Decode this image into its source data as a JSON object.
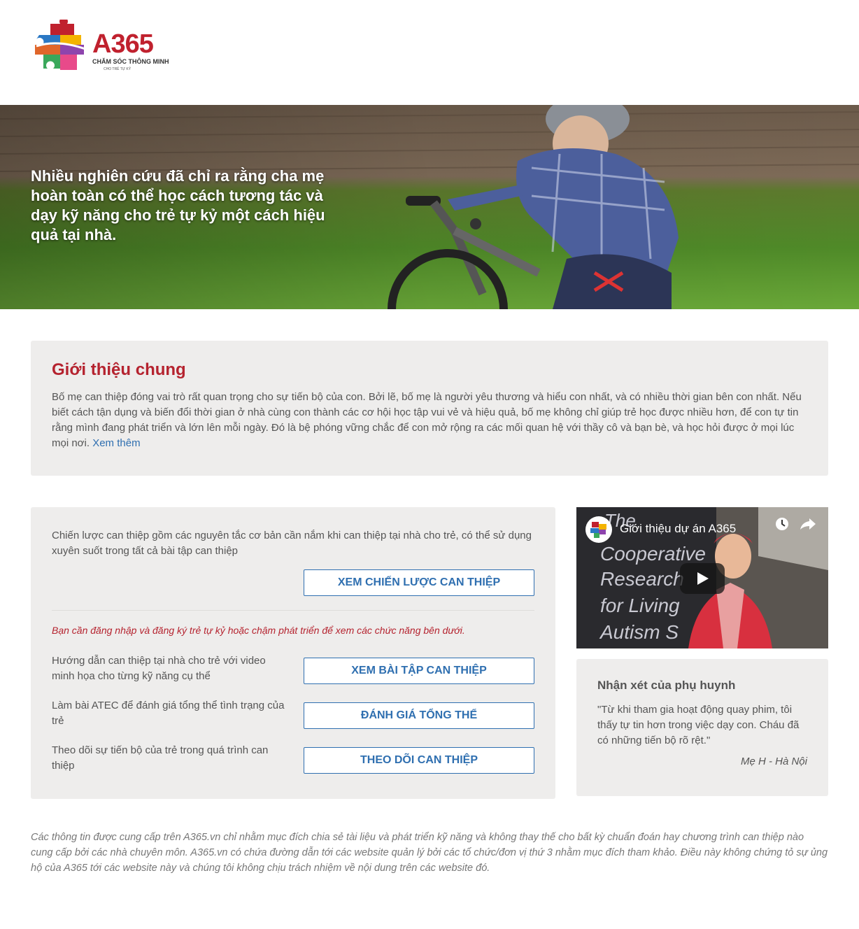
{
  "logo": {
    "brand": "A365",
    "tagline": "CHĂM SÓC THÔNG MINH",
    "subtagline": "CHO TRẺ TỰ KỶ"
  },
  "hero": {
    "text": "Nhiều nghiên cứu đã chỉ ra rằng cha mẹ hoàn toàn có thể học cách tương tác và dạy kỹ năng cho trẻ tự kỷ một cách hiệu quả tại nhà."
  },
  "intro": {
    "title": "Giới thiệu chung",
    "body": "Bố mẹ can thiệp đóng vai trò rất quan trọng cho sự tiến bộ của con. Bởi lẽ, bố mẹ là người yêu thương và hiểu con nhất, và có nhiều thời gian bên con nhất. Nếu biết cách tận dụng và biến đổi thời gian ở nhà cùng con thành các cơ hội học tập vui vẻ và hiệu quả, bố mẹ không chỉ giúp trẻ học được nhiều hơn, để con tự tin rằng mình đang phát triển và lớn lên mỗi ngày. Đó là bệ phóng vững chắc để con mở rộng ra các mối quan hệ với thầy cô và bạn bè, và học hỏi được ở mọi lúc mọi nơi.",
    "link": "Xem thêm"
  },
  "strategy": {
    "description": "Chiến lược can thiệp gồm các nguyên tắc cơ bản cần nắm khi can thiệp tại nhà cho trẻ, có thể sử dụng xuyên suốt trong tất cả bài tập can thiệp",
    "strategy_button": "XEM CHIẾN LƯỢC CAN THIỆP",
    "notice": "Bạn cần đăng nhập và đăng ký trẻ tự kỷ hoặc chậm phát triển để xem các chức năng bên dưới.",
    "rows": [
      {
        "label": "Hướng dẫn can thiệp tại nhà cho trẻ với video minh họa cho từng kỹ năng cụ thể",
        "button": "XEM BÀI TẬP CAN THIỆP"
      },
      {
        "label": "Làm bài ATEC để đánh giá tổng thể tình trạng của trẻ",
        "button": "ĐÁNH GIÁ TỔNG THỂ"
      },
      {
        "label": "Theo dõi sự tiến bộ của trẻ trong quá trình can thiệp",
        "button": "THEO DÕI CAN THIỆP"
      }
    ]
  },
  "video": {
    "title": "Giới thiệu dự án A365",
    "poster_lines": [
      "The",
      "Cooperative",
      "Research",
      "for Living",
      "Autism S"
    ]
  },
  "review": {
    "title": "Nhận xét của phụ huynh",
    "quote": "\"Từ khi tham gia hoạt động quay phim, tôi thấy tự tin hơn trong việc dạy con. Cháu đã có những tiến bộ rõ rệt.\"",
    "author": "Mẹ H - Hà Nội"
  },
  "disclaimer": "Các thông tin được cung cấp trên A365.vn chỉ nhằm mục đích chia sẻ tài liệu và phát triển kỹ năng và không thay thế cho bất kỳ chuẩn đoán hay chương trình can thiệp nào cung cấp bởi các nhà chuyên môn. A365.vn có chứa đường dẫn tới các website quản lý bởi các tổ chức/đơn vị thứ 3 nhằm mục đích tham khảo. Điều này không chứng tỏ sự ủng hộ của A365 tới các website này và chúng tôi không chịu trách nhiệm về nội dung trên các website đó.",
  "colors": {
    "brand_red": "#c0212e",
    "link_blue": "#2f6fb0",
    "card_bg": "#eeedec"
  }
}
